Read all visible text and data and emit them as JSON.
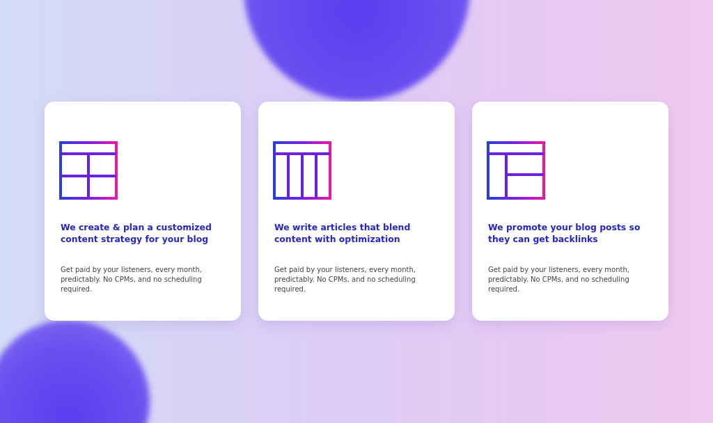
{
  "cards": [
    {
      "kind": "grid",
      "title": "We create & plan a customized content strategy for your blog",
      "body": "Get paid by your listeners, every month, predictably. No CPMs, and no scheduling required."
    },
    {
      "kind": "columns",
      "title": "We write articles that blend content with optimization",
      "body": "Get paid by your listeners, every month, predictably. No CPMs, and no scheduling required."
    },
    {
      "kind": "sidebar",
      "title": "We promote your blog posts so they can get backlinks",
      "body": "Get paid by your listeners, every month, predictably. No CPMs, and no scheduling required."
    }
  ]
}
